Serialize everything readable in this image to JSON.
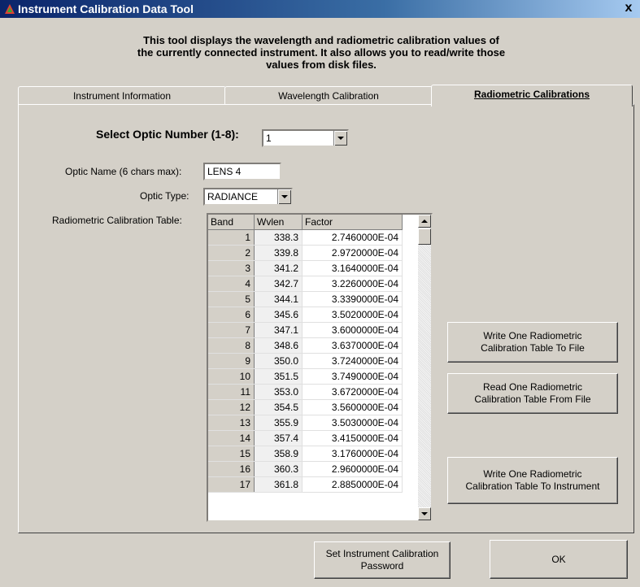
{
  "window": {
    "title": "Instrument Calibration Data Tool",
    "close": "x"
  },
  "description": [
    "This tool displays the wavelength and radiometric calibration values of",
    "the currently connected instrument. It also allows you to read/write those",
    "values from disk files."
  ],
  "tabs": [
    {
      "label": "Instrument Information",
      "active": false
    },
    {
      "label": "Wavelength Calibration",
      "active": false
    },
    {
      "label": "Radiometric Calibrations",
      "active": true
    }
  ],
  "form": {
    "optic_number_label": "Select Optic Number (1-8):",
    "optic_number_value": "1",
    "optic_name_label": "Optic Name (6 chars max):",
    "optic_name_value": "LENS 4",
    "optic_type_label": "Optic Type:",
    "optic_type_value": "RADIANCE",
    "table_label": "Radiometric Calibration Table:"
  },
  "table": {
    "headers": [
      "Band",
      "Wvlen",
      "Factor"
    ],
    "rows": [
      [
        "1",
        "338.3",
        "2.7460000E-04"
      ],
      [
        "2",
        "339.8",
        "2.9720000E-04"
      ],
      [
        "3",
        "341.2",
        "3.1640000E-04"
      ],
      [
        "4",
        "342.7",
        "3.2260000E-04"
      ],
      [
        "5",
        "344.1",
        "3.3390000E-04"
      ],
      [
        "6",
        "345.6",
        "3.5020000E-04"
      ],
      [
        "7",
        "347.1",
        "3.6000000E-04"
      ],
      [
        "8",
        "348.6",
        "3.6370000E-04"
      ],
      [
        "9",
        "350.0",
        "3.7240000E-04"
      ],
      [
        "10",
        "351.5",
        "3.7490000E-04"
      ],
      [
        "11",
        "353.0",
        "3.6720000E-04"
      ],
      [
        "12",
        "354.5",
        "3.5600000E-04"
      ],
      [
        "13",
        "355.9",
        "3.5030000E-04"
      ],
      [
        "14",
        "357.4",
        "3.4150000E-04"
      ],
      [
        "15",
        "358.9",
        "3.1760000E-04"
      ],
      [
        "16",
        "360.3",
        "2.9600000E-04"
      ],
      [
        "17",
        "361.8",
        "2.8850000E-04"
      ]
    ]
  },
  "buttons": {
    "write_file": "Write One Radiometric\nCalibration Table To File",
    "read_file": "Read One Radiometric\nCalibration Table From File",
    "write_instrument": "Write One Radiometric\nCalibration Table To Instrument",
    "set_password": "Set Instrument Calibration\nPassword",
    "ok": "OK"
  },
  "colors": {
    "face": "#d4d0c8",
    "title_start": "#0a246a",
    "title_end": "#a6caf0"
  }
}
